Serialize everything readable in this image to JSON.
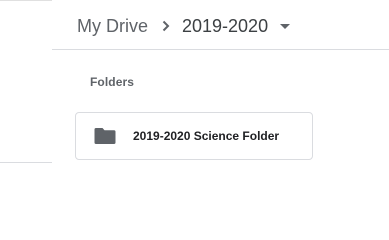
{
  "breadcrumb": {
    "root": "My Drive",
    "current": "2019-2020"
  },
  "folders_section": {
    "label": "Folders",
    "items": [
      {
        "name": "2019-2020 Science Folder"
      }
    ]
  },
  "icons": {
    "separator": "chevron-right-icon",
    "dropdown": "caret-down-icon",
    "folder": "folder-icon"
  },
  "colors": {
    "text_primary": "#202124",
    "text_secondary": "#5f6368",
    "icon_gray": "#5f6368",
    "border": "#dadce0"
  }
}
